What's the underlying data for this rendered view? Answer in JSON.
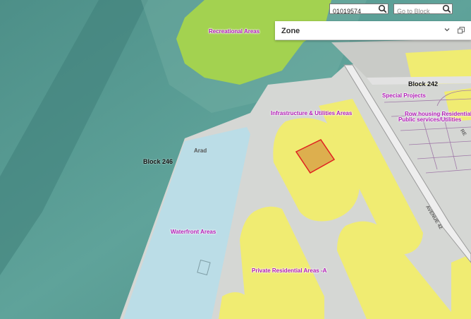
{
  "search": {
    "parcel_value": "01019574",
    "block_placeholder": "Go to Block"
  },
  "zone_panel": {
    "title": "Zone"
  },
  "map": {
    "zone_labels": {
      "recreational": "Recreational Areas",
      "infrastructure": "Infrastructure & Utilities Areas",
      "special_projects": "Special Projects",
      "row_housing": "Row housing Residential A",
      "public_services": "Public services/Utilities",
      "waterfront": "Waterfront Areas",
      "private_residential": "Private Residential Areas -A"
    },
    "blocks": {
      "block_242": "Block 242",
      "block_246": "Block 246"
    },
    "streets": {
      "arad": "Arad",
      "avenue_42": "AVENUE 42",
      "partial_right": "RE"
    },
    "colors": {
      "sea": "#5a9c93",
      "recreational": "#a8d64a",
      "residential": "#f0ec72",
      "waterfront": "#b9dde8",
      "selected_parcel": "#e02020"
    }
  }
}
